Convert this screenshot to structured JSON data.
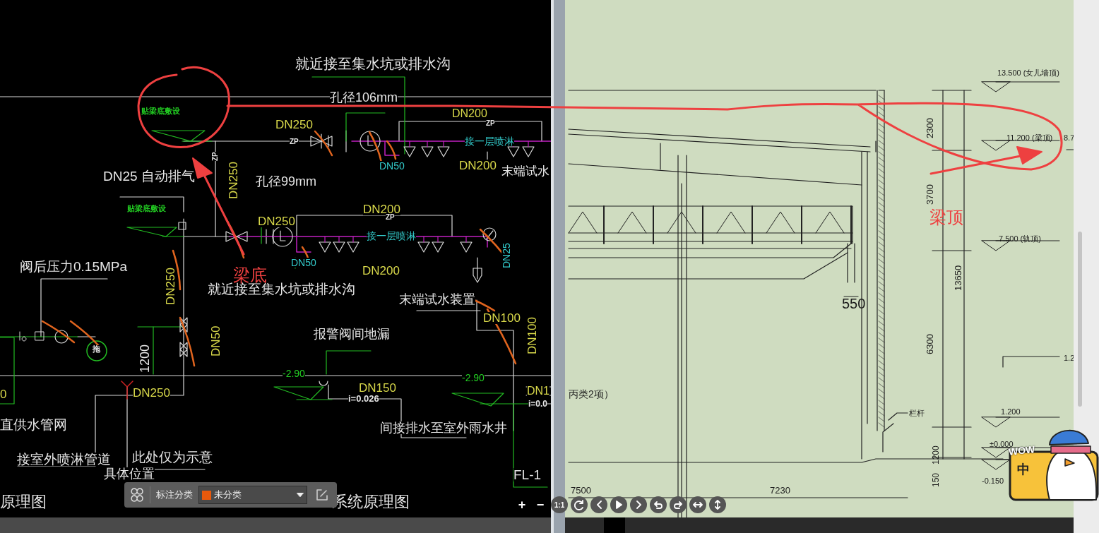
{
  "left_sheet": {
    "labels": [
      {
        "text": "就近接至集水坑或排水沟",
        "color": "#e6e6e6",
        "kind": "horizontal"
      },
      {
        "text": "孔径106mm",
        "color": "#e6e6e6",
        "kind": "horizontal"
      },
      {
        "text": "贴梁底敷设",
        "color": "#22cc22",
        "kind": "horizontal"
      },
      {
        "text": "DN200",
        "color": "#d8d84a",
        "kind": "horizontal"
      },
      {
        "text": "DN250",
        "color": "#d8d84a",
        "kind": "horizontal"
      },
      {
        "text": "ZP",
        "color": "#e6e6e6",
        "kind": "horizontal"
      },
      {
        "text": "ZP",
        "color": "#e6e6e6",
        "kind": "horizontal"
      },
      {
        "text": "接一层喷淋",
        "color": "#33cccc",
        "kind": "horizontal"
      },
      {
        "text": "DN25 自动排气",
        "color": "#e6e6e6",
        "kind": "horizontal"
      },
      {
        "text": "ZP",
        "color": "#e6e6e6",
        "kind": "vertical"
      },
      {
        "text": "DN250",
        "color": "#d8d84a",
        "kind": "vertical"
      },
      {
        "text": "孔径99mm",
        "color": "#e6e6e6",
        "kind": "horizontal"
      },
      {
        "text": "DN50",
        "color": "#33cccc",
        "kind": "horizontal"
      },
      {
        "text": "DN200",
        "color": "#d8d84a",
        "kind": "horizontal"
      },
      {
        "text": "末端试水",
        "color": "#e6e6e6",
        "kind": "horizontal"
      },
      {
        "text": "贴梁底敷设",
        "color": "#22cc22",
        "kind": "horizontal"
      },
      {
        "text": "DN250",
        "color": "#d8d84a",
        "kind": "horizontal"
      },
      {
        "text": "DN200",
        "color": "#d8d84a",
        "kind": "horizontal"
      },
      {
        "text": "ZP",
        "color": "#e6e6e6",
        "kind": "horizontal"
      },
      {
        "text": "接一层喷淋",
        "color": "#33cccc",
        "kind": "horizontal"
      },
      {
        "text": "阀后压力0.15MPa",
        "color": "#e6e6e6",
        "kind": "horizontal"
      },
      {
        "text": "DN50",
        "color": "#33cccc",
        "kind": "horizontal"
      },
      {
        "text": "DN200",
        "color": "#d8d84a",
        "kind": "horizontal"
      },
      {
        "text": "DN25",
        "color": "#33cccc",
        "kind": "vertical"
      },
      {
        "text": "DN250",
        "color": "#d8d84a",
        "kind": "vertical"
      },
      {
        "text": "就近接至集水坑或排水沟",
        "color": "#e6e6e6",
        "kind": "horizontal"
      },
      {
        "text": "末端试水装置",
        "color": "#e6e6e6",
        "kind": "horizontal"
      },
      {
        "text": "DN100",
        "color": "#d8d84a",
        "kind": "horizontal"
      },
      {
        "text": "DN50",
        "color": "#d8d84a",
        "kind": "vertical"
      },
      {
        "text": "报警阀间地漏",
        "color": "#e6e6e6",
        "kind": "horizontal"
      },
      {
        "text": "DN100",
        "color": "#d8d84a",
        "kind": "vertical"
      },
      {
        "text": "拖",
        "color": "#e6e6e6",
        "kind": "horizontal"
      },
      {
        "text": "1200",
        "color": "#e6e6e6",
        "kind": "vertical"
      },
      {
        "text": "-2.90",
        "color": "#22cc22",
        "kind": "horizontal"
      },
      {
        "text": "-2.90",
        "color": "#22cc22",
        "kind": "horizontal"
      },
      {
        "text": "0",
        "color": "#d8d84a",
        "kind": "horizontal"
      },
      {
        "text": "DN250",
        "color": "#d8d84a",
        "kind": "horizontal"
      },
      {
        "text": "DN150",
        "color": "#d8d84a",
        "kind": "horizontal"
      },
      {
        "text": "i=0.026",
        "color": "#e6e6e6",
        "kind": "horizontal"
      },
      {
        "text": "DN1",
        "color": "#d8d84a",
        "kind": "horizontal"
      },
      {
        "text": "i=0.0",
        "color": "#e6e6e6",
        "kind": "horizontal"
      },
      {
        "text": "直供水管网",
        "color": "#e6e6e6",
        "kind": "horizontal"
      },
      {
        "text": "间接排水至室外雨水井",
        "color": "#e6e6e6",
        "kind": "horizontal"
      },
      {
        "text": "接室外喷淋管道",
        "color": "#e6e6e6",
        "kind": "horizontal"
      },
      {
        "text": "此处仅为示意",
        "color": "#e6e6e6",
        "kind": "horizontal"
      },
      {
        "text": "具体位置",
        "color": "#e6e6e6",
        "kind": "horizontal"
      },
      {
        "text": "FL-1",
        "color": "#e6e6e6",
        "kind": "horizontal"
      },
      {
        "text": "原理图",
        "color": "#e6e6e6",
        "kind": "horizontal"
      },
      {
        "text": "系统原理图",
        "color": "#e6e6e6",
        "kind": "horizontal"
      }
    ]
  },
  "right_sheet": {
    "labels": [
      {
        "text": "13.500 (女儿墙顶)",
        "kind": "horizontal"
      },
      {
        "text": "11.200 (梁顶)",
        "kind": "horizontal"
      },
      {
        "text": "8.7",
        "kind": "horizontal"
      },
      {
        "text": "2300",
        "kind": "vertical"
      },
      {
        "text": "3700",
        "kind": "vertical"
      },
      {
        "text": "7.500 (轨顶)",
        "kind": "horizontal"
      },
      {
        "text": "13650",
        "kind": "vertical"
      },
      {
        "text": "550",
        "kind": "horizontal"
      },
      {
        "text": "6300",
        "kind": "vertical"
      },
      {
        "text": "1.2",
        "kind": "horizontal"
      },
      {
        "text": "丙类2项）",
        "kind": "horizontal"
      },
      {
        "text": "1.200",
        "kind": "horizontal"
      },
      {
        "text": "栏杆",
        "kind": "horizontal"
      },
      {
        "text": "±0.000",
        "kind": "horizontal"
      },
      {
        "text": "1200",
        "kind": "vertical"
      },
      {
        "text": "150",
        "kind": "vertical"
      },
      {
        "text": "-0.150",
        "kind": "horizontal"
      },
      {
        "text": "7500",
        "kind": "horizontal"
      },
      {
        "text": "7230",
        "kind": "horizontal"
      }
    ]
  },
  "annotations": [
    {
      "text": "梁底"
    },
    {
      "text": "梁顶"
    }
  ],
  "toolbar": {
    "label": "标注分类",
    "category": {
      "text": "未分类",
      "color": "#e8590c"
    }
  },
  "viewer_controls": {
    "zoom_in": "+",
    "zoom_out": "−",
    "actual_size": "1:1"
  },
  "ime_badge": {
    "exclaim": "WOW",
    "mode": "中"
  }
}
